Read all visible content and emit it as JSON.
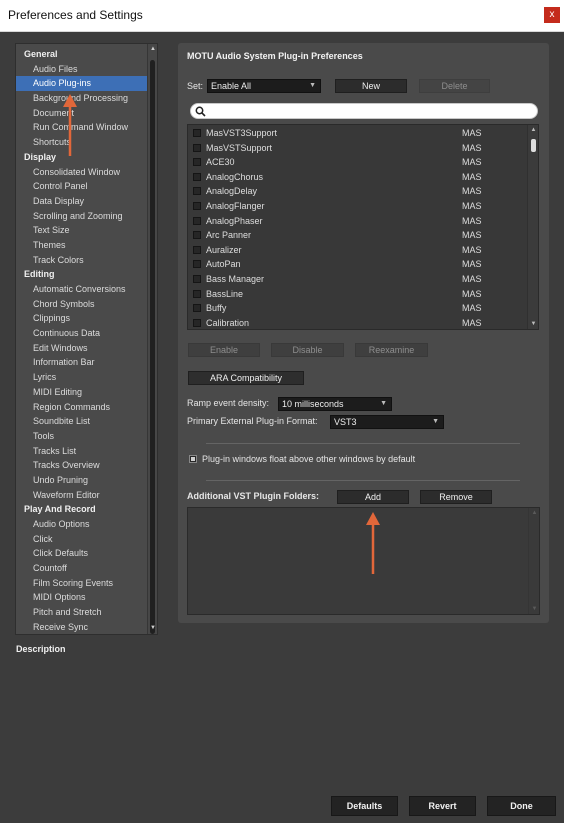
{
  "window": {
    "title": "Preferences and Settings",
    "close_glyph": "x"
  },
  "sidebar": {
    "items": [
      {
        "label": "General",
        "kind": "category"
      },
      {
        "label": "Audio Files",
        "kind": "item"
      },
      {
        "label": "Audio Plug-ins",
        "kind": "item",
        "selected": true
      },
      {
        "label": "Background Processing",
        "kind": "item"
      },
      {
        "label": "Document",
        "kind": "item"
      },
      {
        "label": "Run Command Window",
        "kind": "item"
      },
      {
        "label": "Shortcuts",
        "kind": "item"
      },
      {
        "label": "Display",
        "kind": "category"
      },
      {
        "label": "Consolidated Window",
        "kind": "item"
      },
      {
        "label": "Control Panel",
        "kind": "item"
      },
      {
        "label": "Data Display",
        "kind": "item"
      },
      {
        "label": "Scrolling and Zooming",
        "kind": "item"
      },
      {
        "label": "Text Size",
        "kind": "item"
      },
      {
        "label": "Themes",
        "kind": "item"
      },
      {
        "label": "Track Colors",
        "kind": "item"
      },
      {
        "label": "Editing",
        "kind": "category"
      },
      {
        "label": "Automatic Conversions",
        "kind": "item"
      },
      {
        "label": "Chord Symbols",
        "kind": "item"
      },
      {
        "label": "Clippings",
        "kind": "item"
      },
      {
        "label": "Continuous Data",
        "kind": "item"
      },
      {
        "label": "Edit Windows",
        "kind": "item"
      },
      {
        "label": "Information Bar",
        "kind": "item"
      },
      {
        "label": "Lyrics",
        "kind": "item"
      },
      {
        "label": "MIDI Editing",
        "kind": "item"
      },
      {
        "label": "Region Commands",
        "kind": "item"
      },
      {
        "label": "Soundbite List",
        "kind": "item"
      },
      {
        "label": "Tools",
        "kind": "item"
      },
      {
        "label": "Tracks List",
        "kind": "item"
      },
      {
        "label": "Tracks Overview",
        "kind": "item"
      },
      {
        "label": "Undo Pruning",
        "kind": "item"
      },
      {
        "label": "Waveform Editor",
        "kind": "item"
      },
      {
        "label": "Play And Record",
        "kind": "category"
      },
      {
        "label": "Audio Options",
        "kind": "item"
      },
      {
        "label": "Click",
        "kind": "item"
      },
      {
        "label": "Click Defaults",
        "kind": "item"
      },
      {
        "label": "Countoff",
        "kind": "item"
      },
      {
        "label": "Film Scoring Events",
        "kind": "item"
      },
      {
        "label": "MIDI Options",
        "kind": "item"
      },
      {
        "label": "Pitch and Stretch",
        "kind": "item"
      },
      {
        "label": "Receive Sync",
        "kind": "item"
      }
    ]
  },
  "description_label": "Description",
  "panel": {
    "title": "MOTU Audio System Plug-in Preferences",
    "set_label": "Set:",
    "set_value": "Enable All",
    "new_button": "New",
    "delete_button": "Delete",
    "search": {
      "value": "",
      "placeholder": ""
    },
    "plugins": [
      {
        "name": "MasVST3Support",
        "type": "MAS"
      },
      {
        "name": "MasVSTSupport",
        "type": "MAS"
      },
      {
        "name": "ACE30",
        "type": "MAS"
      },
      {
        "name": "AnalogChorus",
        "type": "MAS"
      },
      {
        "name": "AnalogDelay",
        "type": "MAS"
      },
      {
        "name": "AnalogFlanger",
        "type": "MAS"
      },
      {
        "name": "AnalogPhaser",
        "type": "MAS"
      },
      {
        "name": "Arc Panner",
        "type": "MAS"
      },
      {
        "name": "Auralizer",
        "type": "MAS"
      },
      {
        "name": "AutoPan",
        "type": "MAS"
      },
      {
        "name": "Bass Manager",
        "type": "MAS"
      },
      {
        "name": "BassLine",
        "type": "MAS"
      },
      {
        "name": "Buffy",
        "type": "MAS"
      },
      {
        "name": "Calibration",
        "type": "MAS"
      }
    ],
    "enable_button": "Enable",
    "disable_button": "Disable",
    "reexamine_button": "Reexamine",
    "ara_button": "ARA Compatibility",
    "ramp_label": "Ramp event density:",
    "ramp_value": "10 milliseconds",
    "format_label": "Primary External Plug-in Format:",
    "format_value": "VST3",
    "float_label": "Plug-in windows float above other windows by default",
    "float_checked": true,
    "folders_label": "Additional VST Plugin Folders:",
    "add_button": "Add",
    "remove_button": "Remove"
  },
  "footer": {
    "defaults": "Defaults",
    "revert": "Revert",
    "done": "Done"
  },
  "colors": {
    "selection": "#3d6fb6",
    "annotation_arrow": "#e2673a"
  }
}
